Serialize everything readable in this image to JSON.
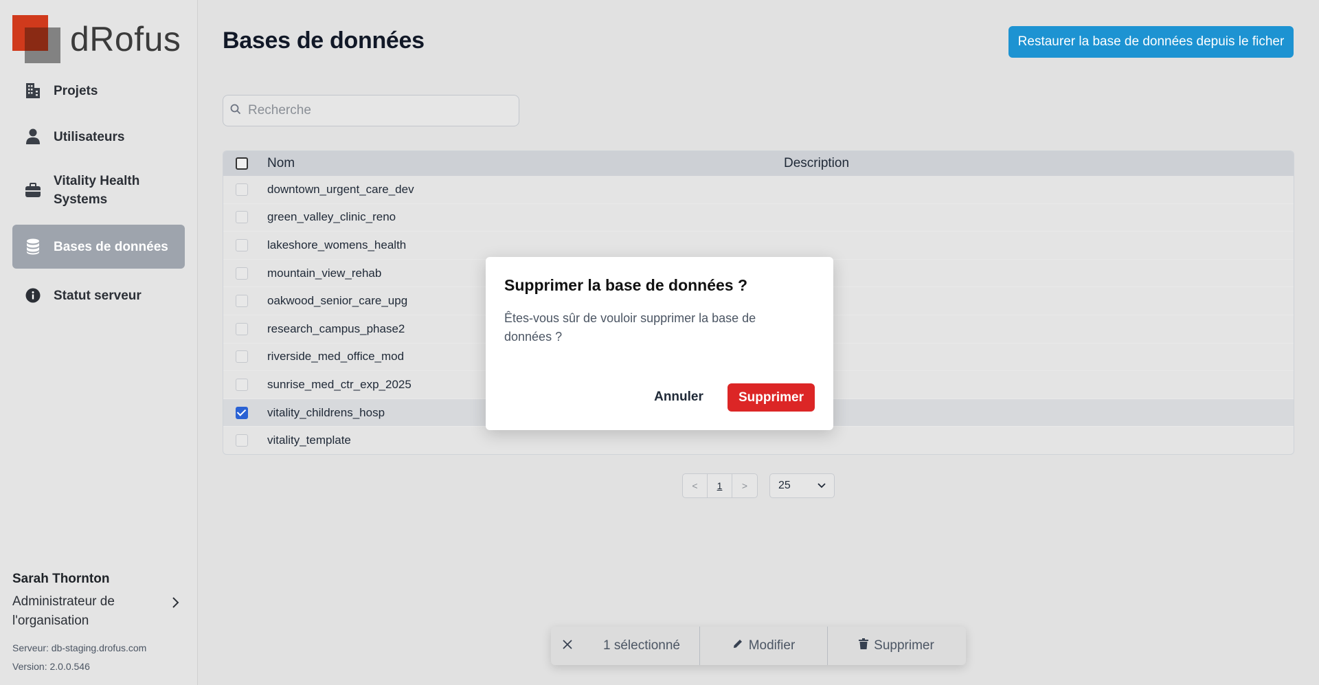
{
  "app": {
    "name": "dRofus"
  },
  "sidebar": {
    "items": [
      {
        "label": "Projets",
        "icon": "building-icon"
      },
      {
        "label": "Utilisateurs",
        "icon": "user-icon"
      },
      {
        "label": "Vitality Health Systems",
        "icon": "briefcase-icon"
      },
      {
        "label": "Bases de données",
        "icon": "database-icon",
        "active": true
      },
      {
        "label": "Statut serveur",
        "icon": "info-icon"
      }
    ]
  },
  "user": {
    "name": "Sarah Thornton",
    "role": "Administrateur de l'organisation",
    "server": "Serveur: db-staging.drofus.com",
    "version": "Version: 2.0.0.546"
  },
  "page": {
    "title": "Bases de données",
    "restore_label": "Restaurer la base de données depuis le ficher",
    "search_placeholder": "Recherche"
  },
  "table": {
    "columns": [
      "Nom",
      "Description"
    ],
    "rows": [
      {
        "name": "downtown_urgent_care_dev",
        "checked": false
      },
      {
        "name": "green_valley_clinic_reno",
        "checked": false
      },
      {
        "name": "lakeshore_womens_health",
        "checked": false
      },
      {
        "name": "mountain_view_rehab",
        "checked": false
      },
      {
        "name": "oakwood_senior_care_upg",
        "checked": false
      },
      {
        "name": "research_campus_phase2",
        "checked": false
      },
      {
        "name": "riverside_med_office_mod",
        "checked": false
      },
      {
        "name": "sunrise_med_ctr_exp_2025",
        "checked": false
      },
      {
        "name": "vitality_childrens_hosp",
        "checked": true
      },
      {
        "name": "vitality_template",
        "checked": false
      }
    ]
  },
  "pagination": {
    "prev": "<",
    "current": "1",
    "next": ">",
    "page_size": "25"
  },
  "modal": {
    "title": "Supprimer la base de données ?",
    "text": "Êtes-vous sûr de vouloir supprimer la base de données ?",
    "cancel_label": "Annuler",
    "confirm_label": "Supprimer"
  },
  "actionbar": {
    "count_label": "1 sélectionné",
    "edit_label": "Modifier",
    "delete_label": "Supprimer"
  },
  "colors": {
    "accent": "#1d93d2",
    "danger": "#dc2626",
    "active_nav": "#9ea4ad",
    "brand_red": "#d03a1c"
  }
}
